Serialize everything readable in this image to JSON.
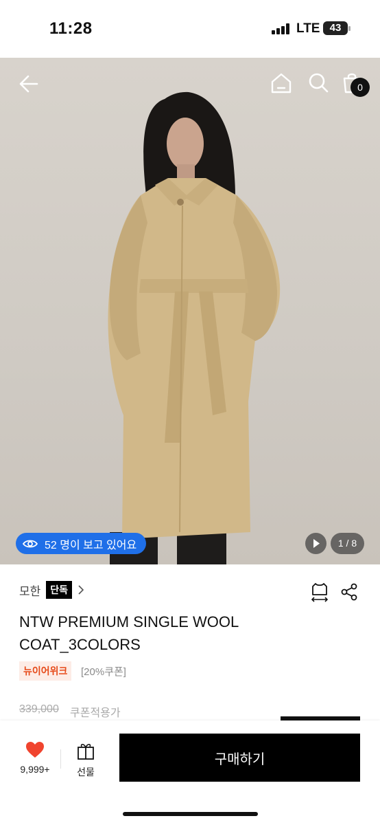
{
  "status_bar": {
    "time": "11:28",
    "network": "LTE",
    "battery": "43"
  },
  "hero": {
    "viewers_text": "52 명이 보고 있어요",
    "page_counter": "1 / 8",
    "cart_count": "0",
    "icons": [
      "back-arrow-icon",
      "home-icon",
      "search-icon",
      "shopping-bag-icon",
      "eye-icon",
      "play-icon"
    ]
  },
  "product": {
    "brand": "모한",
    "brand_badge": "단독",
    "title": "NTW PREMIUM SINGLE WOOL COAT_3COLORS",
    "tag_new": "뉴이어위크",
    "tag_coupon": "[20%쿠폰]",
    "original_price": "339,000",
    "coupon_price_label": "쿠폰적용가"
  },
  "bottom_bar": {
    "like_count": "9,999+",
    "gift_label": "선물",
    "buy_label": "구매하기",
    "colors": {
      "heart": "#f0442e",
      "buy_bg": "#000000",
      "viewers_bg": "#1f6fe8"
    }
  }
}
